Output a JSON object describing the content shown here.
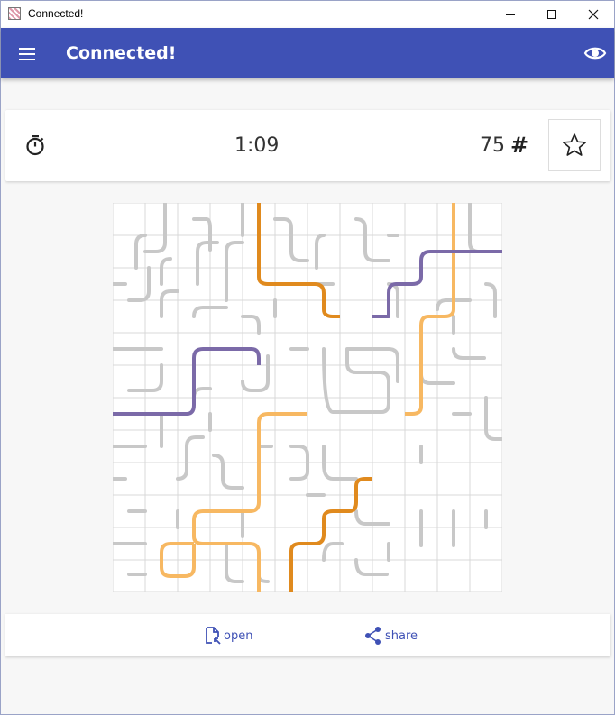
{
  "window": {
    "title": "Connected!",
    "icon": "app-icon"
  },
  "appbar": {
    "title": "Connected!",
    "menu_icon": "hamburger-menu-icon",
    "reveal_icon": "eye-icon",
    "color": "#3f51b5"
  },
  "status": {
    "timer_icon": "stopwatch-icon",
    "time": "1:09",
    "level": "75",
    "level_icon": "hash-icon",
    "favorite_icon": "star-outline-icon"
  },
  "board": {
    "rows": 12,
    "cols": 12,
    "colors": {
      "grid": "#cccccc",
      "pipe_inactive": "#c8c8c8",
      "orange_dark": "#e08a1e",
      "orange_light": "#f7b862",
      "purple": "#7b6aa8"
    }
  },
  "actions": {
    "open_label": "open",
    "open_icon": "open-file-icon",
    "share_label": "share",
    "share_icon": "share-icon"
  }
}
